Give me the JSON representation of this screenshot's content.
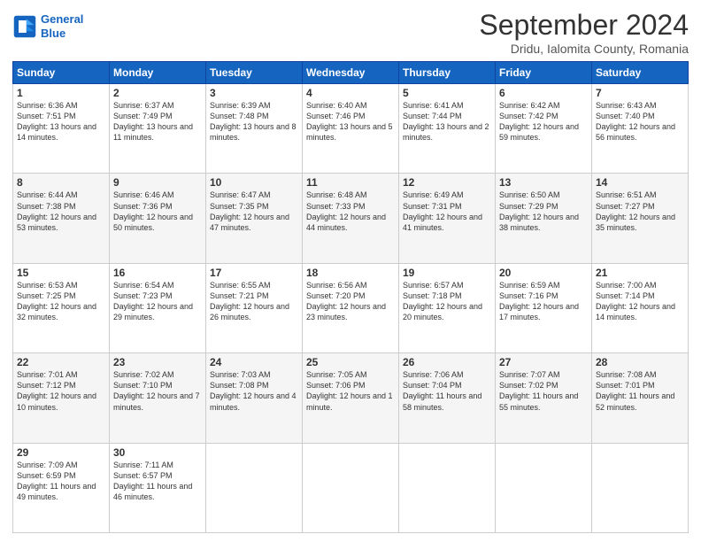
{
  "header": {
    "logo_line1": "General",
    "logo_line2": "Blue",
    "month": "September 2024",
    "location": "Dridu, Ialomita County, Romania"
  },
  "weekdays": [
    "Sunday",
    "Monday",
    "Tuesday",
    "Wednesday",
    "Thursday",
    "Friday",
    "Saturday"
  ],
  "weeks": [
    [
      {
        "day": "1",
        "info": "Sunrise: 6:36 AM\nSunset: 7:51 PM\nDaylight: 13 hours and 14 minutes."
      },
      {
        "day": "2",
        "info": "Sunrise: 6:37 AM\nSunset: 7:49 PM\nDaylight: 13 hours and 11 minutes."
      },
      {
        "day": "3",
        "info": "Sunrise: 6:39 AM\nSunset: 7:48 PM\nDaylight: 13 hours and 8 minutes."
      },
      {
        "day": "4",
        "info": "Sunrise: 6:40 AM\nSunset: 7:46 PM\nDaylight: 13 hours and 5 minutes."
      },
      {
        "day": "5",
        "info": "Sunrise: 6:41 AM\nSunset: 7:44 PM\nDaylight: 13 hours and 2 minutes."
      },
      {
        "day": "6",
        "info": "Sunrise: 6:42 AM\nSunset: 7:42 PM\nDaylight: 12 hours and 59 minutes."
      },
      {
        "day": "7",
        "info": "Sunrise: 6:43 AM\nSunset: 7:40 PM\nDaylight: 12 hours and 56 minutes."
      }
    ],
    [
      {
        "day": "8",
        "info": "Sunrise: 6:44 AM\nSunset: 7:38 PM\nDaylight: 12 hours and 53 minutes."
      },
      {
        "day": "9",
        "info": "Sunrise: 6:46 AM\nSunset: 7:36 PM\nDaylight: 12 hours and 50 minutes."
      },
      {
        "day": "10",
        "info": "Sunrise: 6:47 AM\nSunset: 7:35 PM\nDaylight: 12 hours and 47 minutes."
      },
      {
        "day": "11",
        "info": "Sunrise: 6:48 AM\nSunset: 7:33 PM\nDaylight: 12 hours and 44 minutes."
      },
      {
        "day": "12",
        "info": "Sunrise: 6:49 AM\nSunset: 7:31 PM\nDaylight: 12 hours and 41 minutes."
      },
      {
        "day": "13",
        "info": "Sunrise: 6:50 AM\nSunset: 7:29 PM\nDaylight: 12 hours and 38 minutes."
      },
      {
        "day": "14",
        "info": "Sunrise: 6:51 AM\nSunset: 7:27 PM\nDaylight: 12 hours and 35 minutes."
      }
    ],
    [
      {
        "day": "15",
        "info": "Sunrise: 6:53 AM\nSunset: 7:25 PM\nDaylight: 12 hours and 32 minutes."
      },
      {
        "day": "16",
        "info": "Sunrise: 6:54 AM\nSunset: 7:23 PM\nDaylight: 12 hours and 29 minutes."
      },
      {
        "day": "17",
        "info": "Sunrise: 6:55 AM\nSunset: 7:21 PM\nDaylight: 12 hours and 26 minutes."
      },
      {
        "day": "18",
        "info": "Sunrise: 6:56 AM\nSunset: 7:20 PM\nDaylight: 12 hours and 23 minutes."
      },
      {
        "day": "19",
        "info": "Sunrise: 6:57 AM\nSunset: 7:18 PM\nDaylight: 12 hours and 20 minutes."
      },
      {
        "day": "20",
        "info": "Sunrise: 6:59 AM\nSunset: 7:16 PM\nDaylight: 12 hours and 17 minutes."
      },
      {
        "day": "21",
        "info": "Sunrise: 7:00 AM\nSunset: 7:14 PM\nDaylight: 12 hours and 14 minutes."
      }
    ],
    [
      {
        "day": "22",
        "info": "Sunrise: 7:01 AM\nSunset: 7:12 PM\nDaylight: 12 hours and 10 minutes."
      },
      {
        "day": "23",
        "info": "Sunrise: 7:02 AM\nSunset: 7:10 PM\nDaylight: 12 hours and 7 minutes."
      },
      {
        "day": "24",
        "info": "Sunrise: 7:03 AM\nSunset: 7:08 PM\nDaylight: 12 hours and 4 minutes."
      },
      {
        "day": "25",
        "info": "Sunrise: 7:05 AM\nSunset: 7:06 PM\nDaylight: 12 hours and 1 minute."
      },
      {
        "day": "26",
        "info": "Sunrise: 7:06 AM\nSunset: 7:04 PM\nDaylight: 11 hours and 58 minutes."
      },
      {
        "day": "27",
        "info": "Sunrise: 7:07 AM\nSunset: 7:02 PM\nDaylight: 11 hours and 55 minutes."
      },
      {
        "day": "28",
        "info": "Sunrise: 7:08 AM\nSunset: 7:01 PM\nDaylight: 11 hours and 52 minutes."
      }
    ],
    [
      {
        "day": "29",
        "info": "Sunrise: 7:09 AM\nSunset: 6:59 PM\nDaylight: 11 hours and 49 minutes."
      },
      {
        "day": "30",
        "info": "Sunrise: 7:11 AM\nSunset: 6:57 PM\nDaylight: 11 hours and 46 minutes."
      },
      null,
      null,
      null,
      null,
      null
    ]
  ]
}
